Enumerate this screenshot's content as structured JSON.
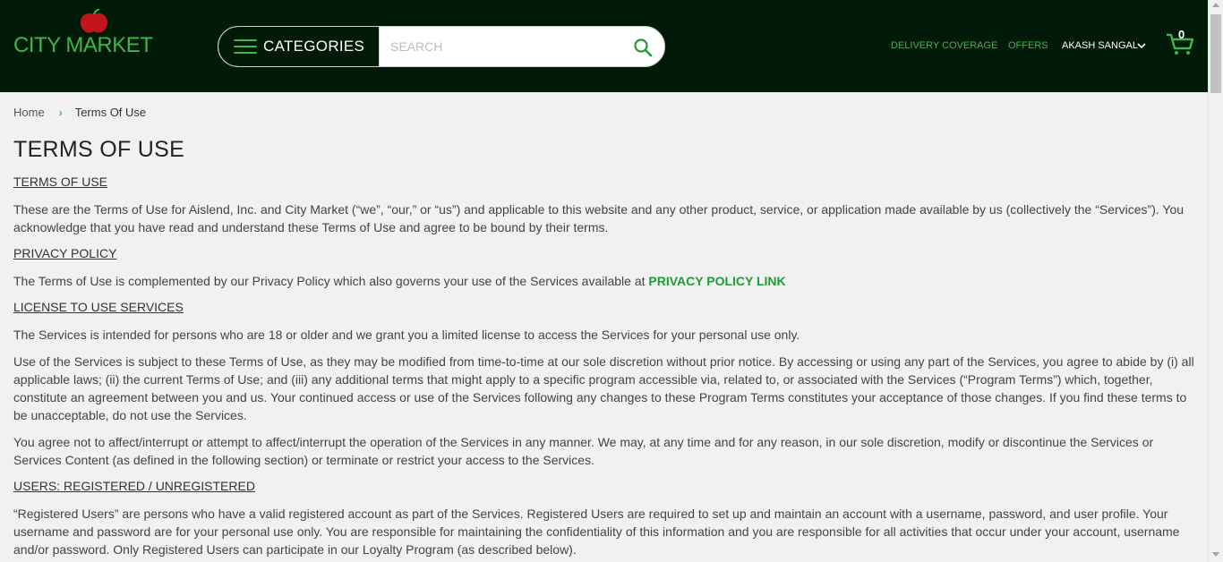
{
  "header": {
    "logo_text": "CITY MARKET",
    "categories_label": "CATEGORIES",
    "search_placeholder": "SEARCH",
    "nav": {
      "delivery": "DELIVERY COVERAGE",
      "offers": "OFFERS",
      "user": "AKASH SANGAL"
    },
    "cart_count": "0",
    "colors": {
      "bg": "#021a08",
      "accent": "#45b34b"
    }
  },
  "breadcrumb": {
    "home": "Home",
    "separator": "›",
    "current": "Terms Of Use"
  },
  "content": {
    "title": "TERMS OF USE",
    "s1_head": "TERMS OF USE",
    "s1_p1": "These are the Terms of Use for Aislend, Inc. and City Market (“we”, “our,” or “us”) and applicable to this website and any other product, service, or application made available by us (collectively the “Services”). You acknowledge that you have read and understand these Terms of Use and agree to be bound by their terms.",
    "s2_head": "PRIVACY POLICY",
    "s2_p1_text": "The Terms of Use is complemented by our Privacy Policy which also governs your use of the Services available at ",
    "s2_p1_link": "PRIVACY POLICY LINK",
    "s3_head": "LICENSE TO USE SERVICES",
    "s3_p1": "The Services is intended for persons who are 18 or older and we grant you a limited license to access the Services for your personal use only.",
    "s3_p2": "Use of the Services is subject to these Terms of Use, as they may be modified from time-to-time at our sole discretion without prior notice. By accessing or using any part of the Services, you agree to abide by (i) all applicable laws; (ii) the current Terms of Use; and (iii) any additional terms that might apply to a specific program accessible via, related to, or associated with the Services (“Program Terms”) which, together, constitute an agreement between you and us. Your continued access or use of the Services following any changes to these Program Terms constitutes your acceptance of those changes. If you find these terms to be unacceptable, do not use the Services.",
    "s3_p3": "You agree not to affect/interrupt or attempt to affect/interrupt the operation of the Services in any manner. We may, at any time and for any reason, in our sole discretion, modify or discontinue the Services or Services Content (as defined in the following section) or terminate or restrict your access to the Services.",
    "s4_head": "USERS: REGISTERED / UNREGISTERED",
    "s4_p1": "“Registered Users” are persons who have a valid registered account as part of the Services. Registered Users are required to set up and maintain an account with a username, password, and user profile. Your username and password are for your personal use only. You are responsible for maintaining the confidentiality of this information and you are responsible for all activities that occur under your account, username and/or password. Only Registered Users can participate in our Loyalty Program (as described below)."
  }
}
